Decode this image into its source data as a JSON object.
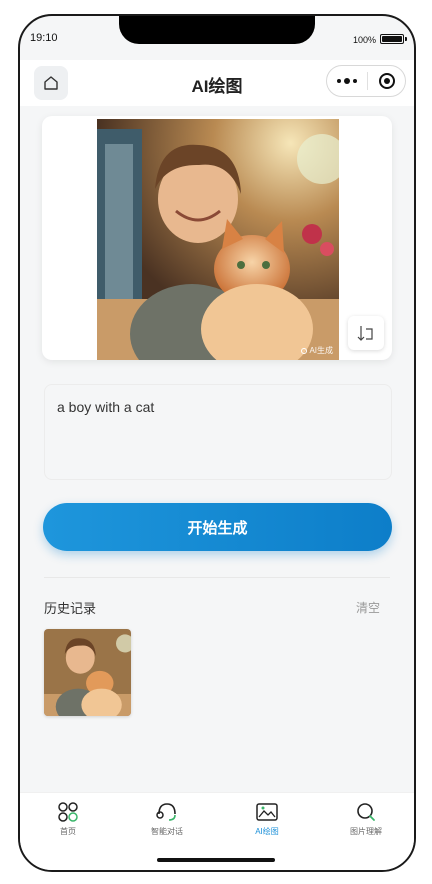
{
  "status_bar": {
    "time": "19:10",
    "battery_text": "100%"
  },
  "nav": {
    "title": "AI绘图",
    "home_icon": "home-icon",
    "more_icon": "more-dots-icon",
    "target_icon": "target-icon"
  },
  "image_card": {
    "watermark": "AI生成",
    "save_icon": "save-download-icon"
  },
  "prompt": {
    "value": "a boy with a cat"
  },
  "actions": {
    "generate_label": "开始生成"
  },
  "history": {
    "title": "历史记录",
    "clear_label": "清空"
  },
  "tabs": [
    {
      "label": "首页",
      "icon": "apps-icon"
    },
    {
      "label": "智能对话",
      "icon": "headset-icon"
    },
    {
      "label": "AI绘图",
      "icon": "image-icon",
      "active": true
    },
    {
      "label": "图片理解",
      "icon": "search-icon"
    }
  ],
  "colors": {
    "accent": "#1a8fd8",
    "button_gradient_start": "#1e96dc",
    "button_gradient_end": "#0d7ec9"
  }
}
